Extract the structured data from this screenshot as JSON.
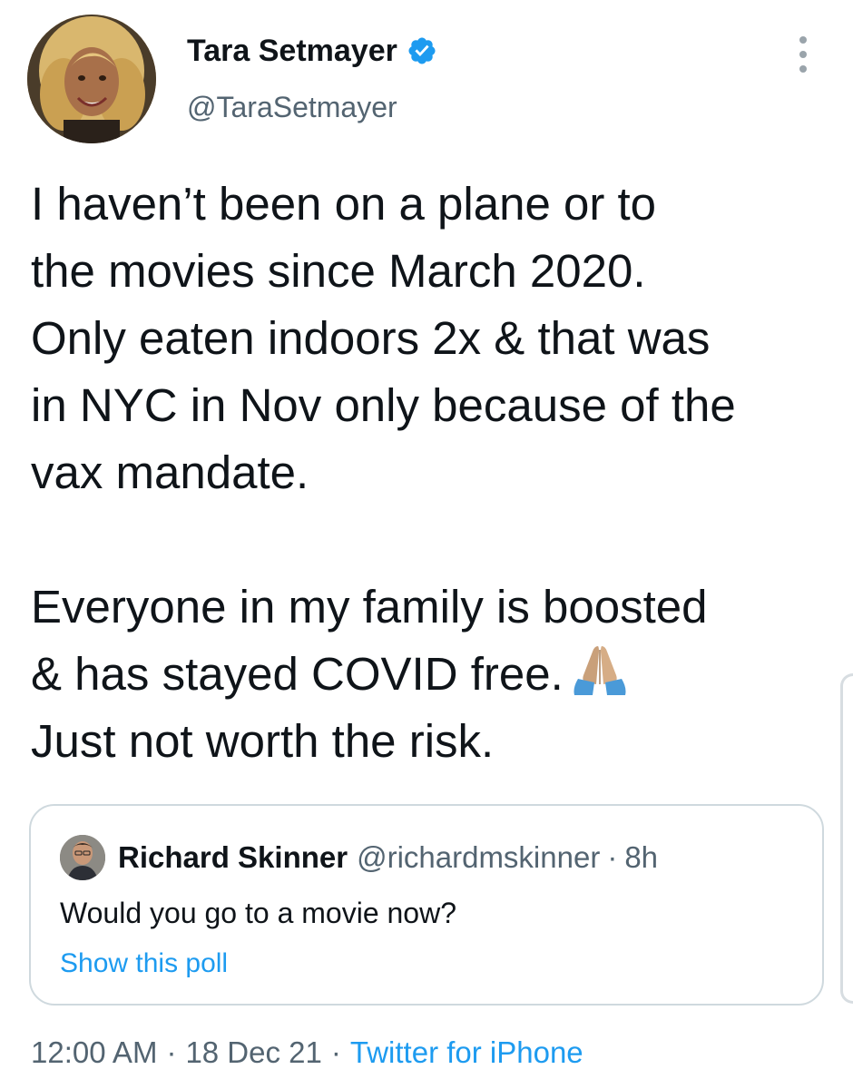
{
  "tweet": {
    "author": {
      "name": "Tara Setmayer",
      "handle": "@TaraSetmayer",
      "verified": true,
      "avatar_icon": "profile-photo"
    },
    "more_icon": "more-vertical-icon",
    "text": {
      "paragraph1_lines": [
        "I haven’t been on a plane or to",
        "the movies since March 2020.",
        "Only eaten indoors 2x & that was",
        "in NYC in Nov only because of the",
        "vax mandate."
      ],
      "paragraph2_lines": [
        "Everyone in my family is boosted",
        "& has stayed COVID free.",
        "Just not worth the risk."
      ],
      "emoji": "folded-hands-emoji"
    },
    "quoted_tweet": {
      "author_name": "Richard Skinner",
      "author_handle": "@richardmskinner",
      "separator": "·",
      "time": "8h",
      "text": "Would you go to a movie now?",
      "poll_link": "Show this poll"
    },
    "meta": {
      "time": "12:00 AM",
      "separator": "·",
      "date": "18 Dec 21",
      "source": "Twitter for iPhone"
    }
  },
  "colors": {
    "text_primary": "#0f1419",
    "text_secondary": "#536471",
    "link_blue": "#1d9bf0",
    "verified_blue": "#1d9bf0",
    "border": "#cfd9de"
  }
}
